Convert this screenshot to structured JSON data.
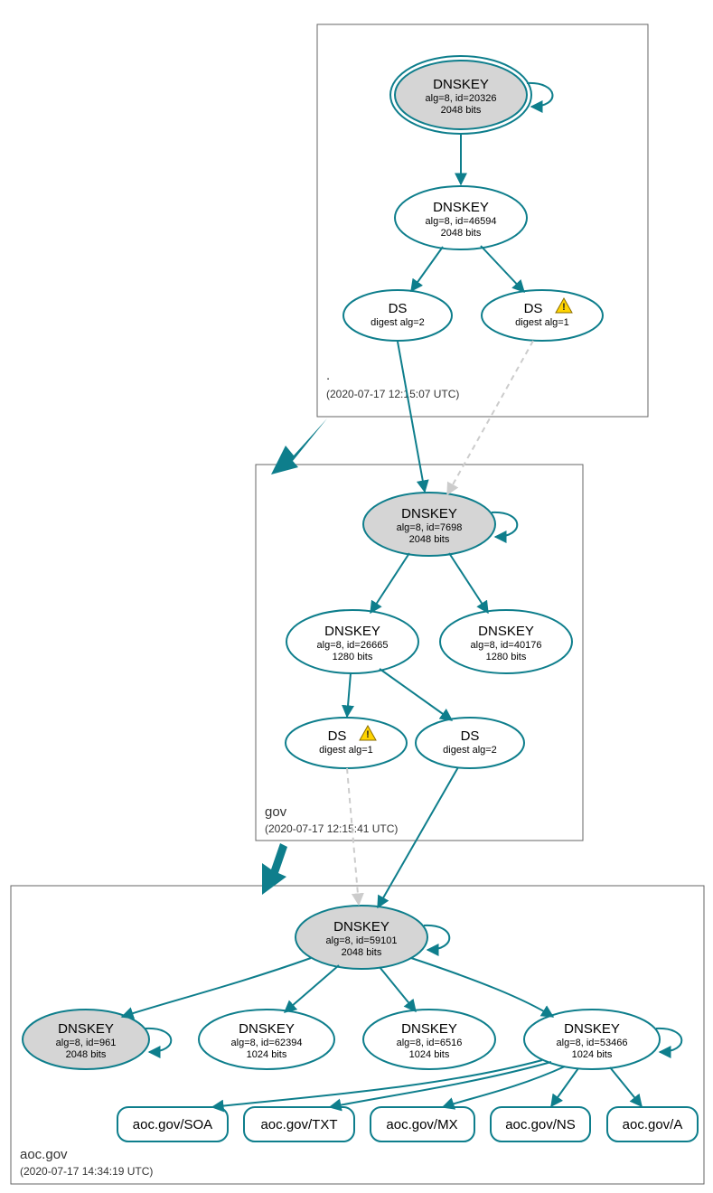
{
  "colors": {
    "teal": "#0e7e8c",
    "node_gray": "#d5d5d5",
    "dashed": "#cccccc"
  },
  "zones": {
    "root": {
      "label": ".",
      "timestamp": "(2020-07-17 12:15:07 UTC)"
    },
    "gov": {
      "label": "gov",
      "timestamp": "(2020-07-17 12:15:41 UTC)"
    },
    "aocgov": {
      "label": "aoc.gov",
      "timestamp": "(2020-07-17 14:34:19 UTC)"
    }
  },
  "nodes": {
    "root_ksk": {
      "title": "DNSKEY",
      "line2": "alg=8, id=20326",
      "line3": "2048 bits"
    },
    "root_zsk": {
      "title": "DNSKEY",
      "line2": "alg=8, id=46594",
      "line3": "2048 bits"
    },
    "root_ds2": {
      "title": "DS",
      "line2": "digest alg=2"
    },
    "root_ds1": {
      "title": "DS",
      "line2": "digest alg=1"
    },
    "gov_ksk": {
      "title": "DNSKEY",
      "line2": "alg=8, id=7698",
      "line3": "2048 bits"
    },
    "gov_zsk_a": {
      "title": "DNSKEY",
      "line2": "alg=8, id=26665",
      "line3": "1280 bits"
    },
    "gov_zsk_b": {
      "title": "DNSKEY",
      "line2": "alg=8, id=40176",
      "line3": "1280 bits"
    },
    "gov_ds1": {
      "title": "DS",
      "line2": "digest alg=1"
    },
    "gov_ds2": {
      "title": "DS",
      "line2": "digest alg=2"
    },
    "aoc_ksk": {
      "title": "DNSKEY",
      "line2": "alg=8, id=59101",
      "line3": "2048 bits"
    },
    "aoc_key961": {
      "title": "DNSKEY",
      "line2": "alg=8, id=961",
      "line3": "2048 bits"
    },
    "aoc_key62394": {
      "title": "DNSKEY",
      "line2": "alg=8, id=62394",
      "line3": "1024 bits"
    },
    "aoc_key6516": {
      "title": "DNSKEY",
      "line2": "alg=8, id=6516",
      "line3": "1024 bits"
    },
    "aoc_key53466": {
      "title": "DNSKEY",
      "line2": "alg=8, id=53466",
      "line3": "1024 bits"
    }
  },
  "rrsets": {
    "soa": "aoc.gov/SOA",
    "txt": "aoc.gov/TXT",
    "mx": "aoc.gov/MX",
    "ns": "aoc.gov/NS",
    "a": "aoc.gov/A"
  }
}
